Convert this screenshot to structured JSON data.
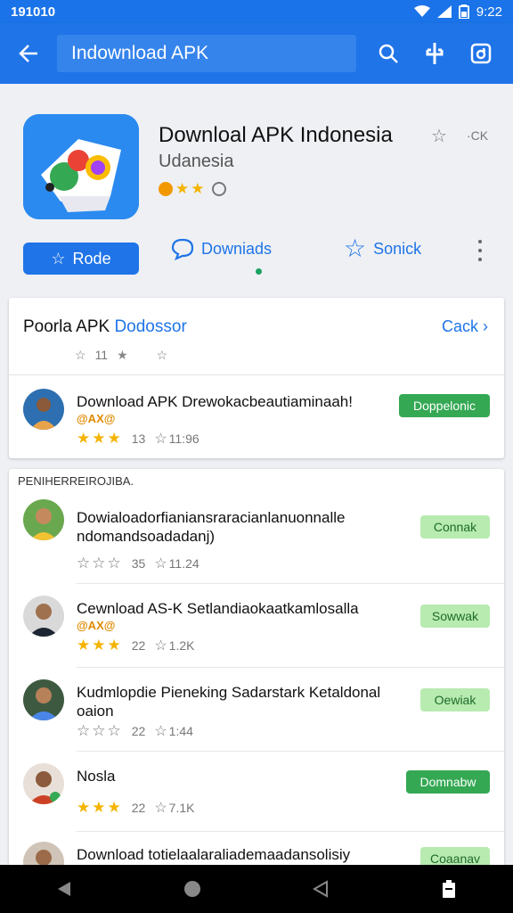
{
  "status_bar": {
    "left_text": "191010",
    "time": "9:22"
  },
  "app_bar": {
    "search_text": "Indownload APK"
  },
  "app_header": {
    "title": "Downloal APK Indonesia",
    "subtitle": "Udanesia",
    "close_label": "·CK",
    "rode_button": "Rode",
    "downloads_tab": "Downiads",
    "sonick_tab": "Sonick"
  },
  "featured_card": {
    "title_black": "Poorla APK ",
    "title_blue": "Dodossor",
    "link": "Cack",
    "meta_count": "11",
    "item": {
      "title": "Download APK Drewokacbeautiaminaah!",
      "badge": "@AX@",
      "rating_count": "13",
      "downloads": "11:96",
      "button": "Doppelonic"
    }
  },
  "list_section": {
    "label": "PENIHERREIROJIBA.",
    "items": [
      {
        "title": "Dowialoadorfianiansraracianlanuonnalle ndomandsoadadanj)",
        "rating_count": "35",
        "downloads": "11.24",
        "button": "Connak"
      },
      {
        "title": "Cewnload AS-K Setlandiaokaatkamlosalla",
        "badge": "@AX@",
        "rating_count": "22",
        "downloads": "1.2K",
        "button": "Sowwak"
      },
      {
        "title": "Kudmlopdie Pieneking Sadarstark Ketaldonal oaion",
        "rating_count": "22",
        "downloads": "1:44",
        "button": "Oewiak"
      },
      {
        "title": "Nosla",
        "rating_count": "22",
        "downloads": "7.1K",
        "button": "Domnabw"
      },
      {
        "title": "Download totielaalaraliademaadansolisiy",
        "button": "Coaanav"
      }
    ]
  },
  "colors": {
    "primary": "#1f74e8",
    "green": "#34a853",
    "light_green": "#b8ebb0",
    "star": "#f4b400"
  }
}
